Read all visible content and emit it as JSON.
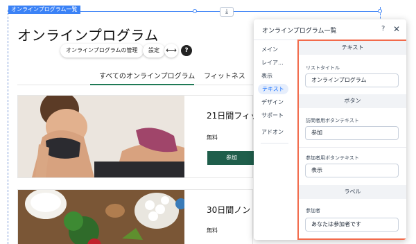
{
  "selection": {
    "tag": "オンラインプログラム一覧",
    "anchor_icon": "⤓"
  },
  "page": {
    "title": "オンラインプログラム",
    "pills": {
      "manage": "オンラインプログラムの管理",
      "settings": "設定",
      "stretch_icon": "⟷",
      "help_icon": "?"
    },
    "tabs": [
      {
        "label": "すべてのオンラインプログラム",
        "active": true
      },
      {
        "label": "フィットネス",
        "active": false
      }
    ],
    "cards": [
      {
        "title": "21日間フィッ",
        "price": "無料",
        "button": "参加"
      },
      {
        "title": "30日間ノン",
        "price": "無料"
      }
    ]
  },
  "panel": {
    "title": "オンラインプログラム一覧",
    "help_icon": "?",
    "close_icon": "✕",
    "nav": [
      "メイン",
      "レイア...",
      "表示",
      "テキスト",
      "デザイン",
      "サポート",
      "アドオン"
    ],
    "active_nav": "テキスト",
    "sections": {
      "text_header": "テキスト",
      "list_title_label": "リストタイトル",
      "list_title_value": "オンラインプログラム",
      "button_header": "ボタン",
      "visitor_btn_label": "訪問者用ボタンテキスト",
      "visitor_btn_value": "参加",
      "participant_btn_label": "参加者用ボタンテキスト",
      "participant_btn_value": "表示",
      "label_header": "ラベル",
      "participant_label": "参加者",
      "participant_value": "あなたは参加者です"
    }
  },
  "colors": {
    "accent": "#116dff",
    "highlight": "#f26a4b",
    "button": "#1f5e4b",
    "tab_underline": "#1f7a55"
  }
}
